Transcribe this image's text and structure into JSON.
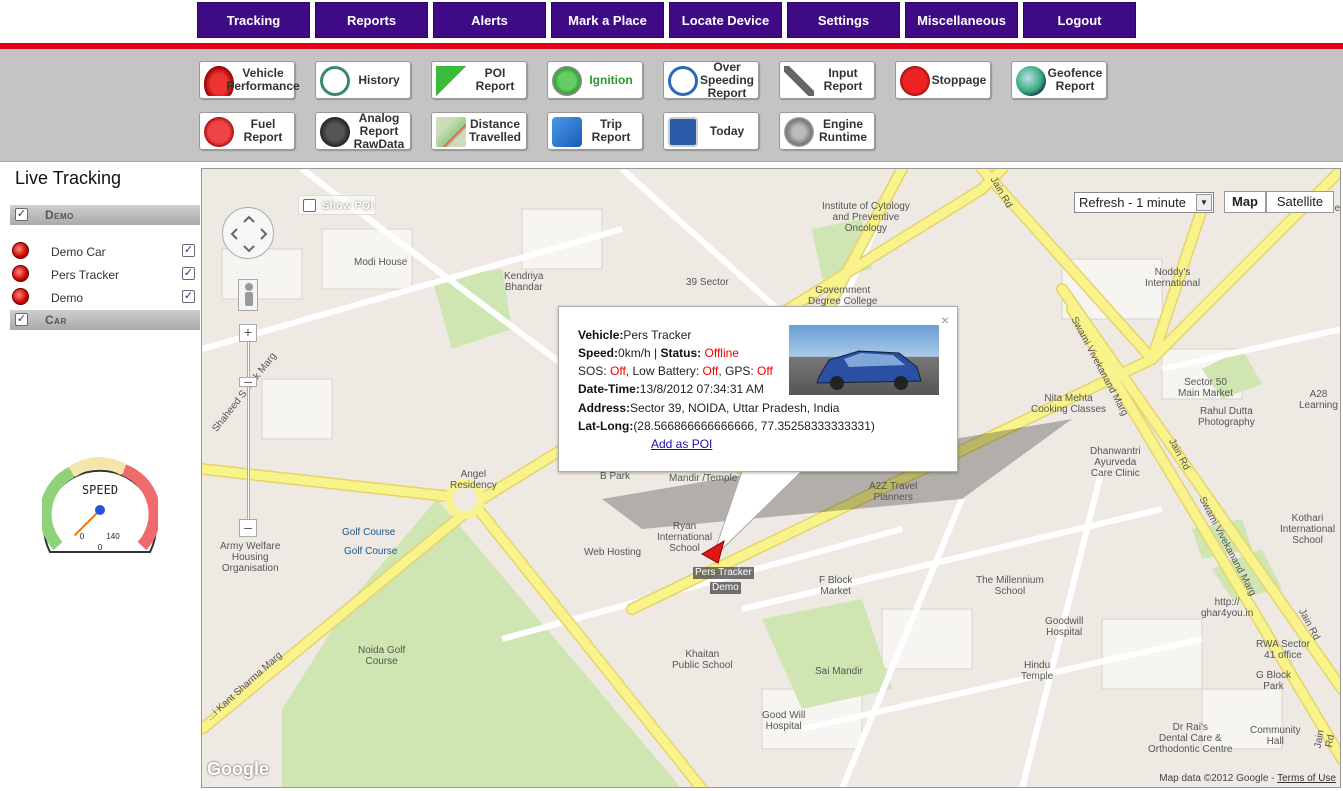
{
  "nav": {
    "items": [
      "Tracking",
      "Reports",
      "Alerts",
      "Mark a Place",
      "Locate Device",
      "Settings",
      "Miscellaneous",
      "Logout"
    ]
  },
  "toolbar": {
    "row1": [
      {
        "label": "Vehicle\nPerformance",
        "icon": "car-icon"
      },
      {
        "label": "History",
        "icon": "clock-icon"
      },
      {
        "label": "POI\nReport",
        "icon": "flag-icon"
      },
      {
        "label": "Ignition",
        "icon": "start-icon"
      },
      {
        "label": "Over\nSpeeding\nReport",
        "icon": "speedometer-icon"
      },
      {
        "label": "Input\nReport",
        "icon": "plug-icon"
      },
      {
        "label": "Stoppage",
        "icon": "stop-sign-icon"
      },
      {
        "label": "Geofence\nReport",
        "icon": "globe-icon"
      }
    ],
    "row2": [
      {
        "label": "Fuel\nReport",
        "icon": "fuel-icon"
      },
      {
        "label": "Analog\nReport\nRawData",
        "icon": "analog-gauge-icon"
      },
      {
        "label": "Distance\nTravelled",
        "icon": "distance-map-icon"
      },
      {
        "label": "Trip\nReport",
        "icon": "trip-arrow-icon"
      },
      {
        "label": "Today",
        "icon": "calendar-icon"
      },
      {
        "label": "Engine\nRuntime",
        "icon": "engine-icon"
      }
    ]
  },
  "sidebar": {
    "title": "Live Tracking",
    "groups": [
      {
        "name": "Demo",
        "vehicles": [
          "Demo Car",
          "Pers Tracker",
          "Demo"
        ]
      },
      {
        "name": "Car",
        "vehicles": []
      }
    ]
  },
  "gauge": {
    "label": "SPEED",
    "value": 0,
    "max": 140,
    "readout": "0",
    "min_label": "0",
    "max_label": "140"
  },
  "map": {
    "show_poi_label": "Show POI",
    "refresh_value": "Refresh - 1 minute",
    "map_type_map": "Map",
    "map_type_satellite": "Satellite",
    "google_logo": "Google",
    "attribution": "Map data ©2012 Google - ",
    "terms": "Terms of Use",
    "marker_label_1": "Pers Tracker",
    "marker_label_2": "Demo",
    "place_labels": {
      "cytology": "Institute of Cytology\nand Preventive\nOncology",
      "modi_house": "Modi House",
      "kendriya": "Kendriya\nBhandar",
      "sector39": "39 Sector",
      "govt_college": "Government\nDegree College",
      "noddys": "Noddy's\nInternational",
      "sector50": "Sector 50\nMain Market",
      "a28": "A28\nLearning",
      "rahul": "Rahul Dutta\nPhotography",
      "nita": "Nita Mehta\nCooking Classes",
      "dhanwantri": "Dhanwantri\nAyurveda\nCare Clinic",
      "a2z": "A2Z Travel\nPlanners",
      "ryan": "Ryan\nInternational\nSchool",
      "web_hosting": "Web Hosting",
      "angel": "Angel\nResidency",
      "golf1": "Golf Course",
      "golf2": "Golf Course",
      "army": "Army Welfare\nHousing\nOrganisation",
      "noida_golf": "Noida Golf\nCourse",
      "khaitan": "Khaitan\nPublic School",
      "sai_mandir": "Sai Mandir",
      "good_will": "Good Will\nHospital",
      "fblock": "F Block\nMarket",
      "millennium": "The Millennium\nSchool",
      "goodwill_hosp": "Goodwill\nHospital",
      "hindu_temple": "Hindu\nTemple",
      "ghar4you": "http://\nghar4you.in",
      "rwa": "RWA Sector\n41 office",
      "gblock": "G Block\nPark",
      "drrai": "Dr Rai's\nDental Care &\nOrthodontic Centre",
      "community": "Community\nHall",
      "kothari": "Kothari\nInternational\nSchool",
      "bpark": "B Park",
      "mandir": "Mandir /Temple",
      "shaheed": "Shaheed S...rak Marg",
      "kant_sharma": "...i Kant Sharma Marg",
      "swami1": "Swami Vivekanand Marg",
      "swami2": "Swami Vivekanand Marg",
      "jain_rd1": "Jain Rd",
      "jain_rd2": "Jain Rd",
      "jain_rd3": "Jain Rd",
      "jain_rd_top": "Jain Rd",
      "temple_right": "Temple"
    }
  },
  "info_window": {
    "vehicle_label": "Vehicle:",
    "vehicle_value": "Pers Tracker",
    "speed_label": "Speed:",
    "speed_value": "0km/h",
    "sep": " | ",
    "status_label": "Status:",
    "status_value": "Offline",
    "sos_prefix": "SOS: ",
    "sos_value": "Off",
    "battery_prefix": ", Low Battery: ",
    "battery_value": "Off",
    "gps_prefix": ", GPS: ",
    "gps_value": "Off",
    "datetime_label": "Date-Time:",
    "datetime_value": "13/8/2012 07:34:31 AM",
    "address_label": "Address:",
    "address_value": "Sector 39, NOIDA, Uttar Pradesh, India",
    "latlong_label": "Lat-Long:",
    "latlong_value": "(28.566866666666666, 77.35258333333331)",
    "add_poi": "Add as POI",
    "close": "×"
  },
  "colors": {
    "nav_bg": "#3f0a85",
    "red_bar": "#e3001b",
    "toolbar_bg": "#c4c4c4",
    "road_major": "#f8f38b",
    "park_green": "#cfe5b2",
    "status_red": "#e00000"
  }
}
